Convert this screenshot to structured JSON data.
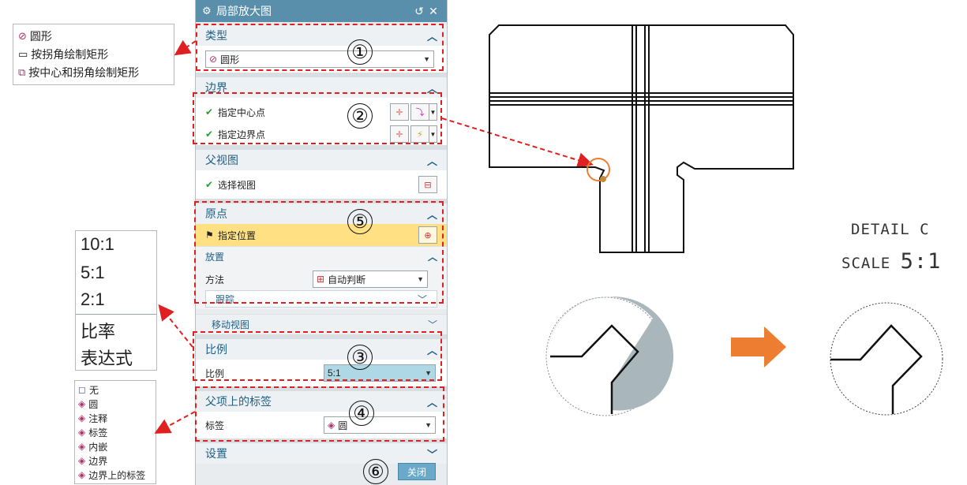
{
  "dialog": {
    "title": "局部放大图",
    "sections": {
      "type": {
        "header": "类型",
        "selected": "圆形"
      },
      "boundary": {
        "header": "边界",
        "row1": "指定中心点",
        "row2": "指定边界点"
      },
      "parent_view": {
        "header": "父视图",
        "row1": "选择视图"
      },
      "origin": {
        "header": "原点",
        "specify": "指定位置",
        "placement_header": "放置",
        "method_label": "方法",
        "method_value": "自动判断",
        "track_header": "跟踪",
        "move_view": "移动视图"
      },
      "scale": {
        "header": "比例",
        "label": "比例",
        "value": "5:1"
      },
      "parent_label": {
        "header": "父项上的标签",
        "label": "标签",
        "value": "圆"
      },
      "settings": {
        "header": "设置"
      }
    },
    "close_button": "关闭"
  },
  "type_options": [
    "圆形",
    "按拐角绘制矩形",
    "按中心和拐角绘制矩形"
  ],
  "scale_options": [
    "10:1",
    "5:1",
    "2:1",
    "比率",
    "表达式"
  ],
  "label_options": [
    "无",
    "圆",
    "注释",
    "标签",
    "内嵌",
    "边界",
    "边界上的标签"
  ],
  "callouts": [
    "①",
    "②",
    "③",
    "④",
    "⑤",
    "⑥"
  ],
  "detail": {
    "line1": "DETAIL C",
    "line2_prefix": "SCALE",
    "line2_value": "5:1"
  },
  "colors": {
    "title_bar": "#5a8fab",
    "section_text": "#1f5f86",
    "highlight": "#ffe083",
    "dashed": "#e02020",
    "arrow": "#ed7d31",
    "scale_field": "#aed8e6"
  }
}
